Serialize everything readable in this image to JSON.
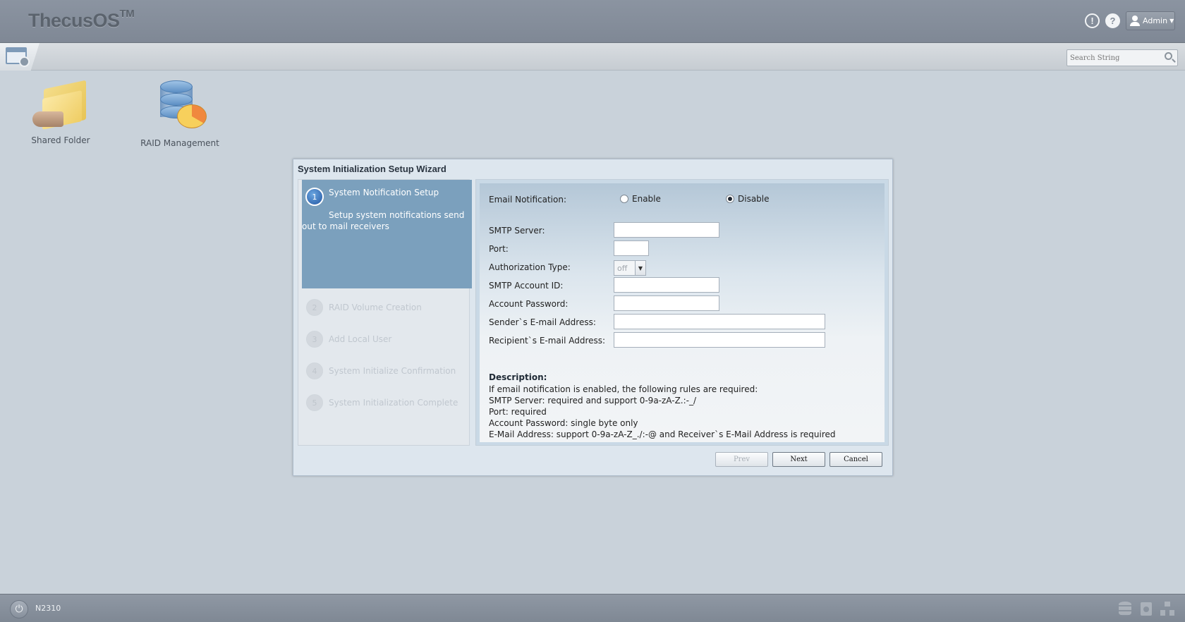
{
  "header": {
    "brand": "ThecusOS",
    "brand_mark": "TM",
    "admin_label": "Admin",
    "icons": [
      "alert-icon",
      "help-icon",
      "user-icon"
    ]
  },
  "toolbar": {
    "search_placeholder": "Search String"
  },
  "desktop": {
    "shortcuts": [
      {
        "label": "Shared Folder",
        "icon": "shared-folder-icon"
      },
      {
        "label": "RAID Management",
        "icon": "raid-management-icon"
      }
    ]
  },
  "wizard": {
    "title": "System Initialization Setup Wizard",
    "active_step": {
      "number": "1",
      "title": "System Notification Setup",
      "description": "Setup system notifications send out to mail receivers"
    },
    "steps": [
      {
        "number": "2",
        "label": "RAID Volume Creation"
      },
      {
        "number": "3",
        "label": "Add Local User"
      },
      {
        "number": "4",
        "label": "System Initialize Confirmation"
      },
      {
        "number": "5",
        "label": "System Initialization Complete"
      }
    ],
    "form": {
      "email_notification_label": "Email Notification:",
      "enable_label": "Enable",
      "disable_label": "Disable",
      "selected": "Disable",
      "smtp_server_label": "SMTP Server:",
      "smtp_server_value": "",
      "port_label": "Port:",
      "port_value": "",
      "auth_type_label": "Authorization Type:",
      "auth_type_value": "off",
      "smtp_account_label": "SMTP Account ID:",
      "smtp_account_value": "",
      "account_password_label": "Account Password:",
      "account_password_value": "",
      "sender_label": "Sender`s E-mail Address:",
      "sender_value": "",
      "recipient_label": "Recipient`s E-mail Address:",
      "recipient_value": ""
    },
    "description": {
      "title": "Description:",
      "lines": [
        "If email notification is enabled, the following rules are required:",
        "SMTP Server: required and support 0-9a-zA-Z.:-_/",
        "Port: required",
        "Account Password: single byte only",
        "E-Mail Address: support 0-9a-zA-Z_./:-@ and Receiver`s E-Mail Address is required"
      ]
    },
    "buttons": {
      "prev": "Prev",
      "next": "Next",
      "cancel": "Cancel"
    }
  },
  "footer": {
    "model": "N2310"
  }
}
